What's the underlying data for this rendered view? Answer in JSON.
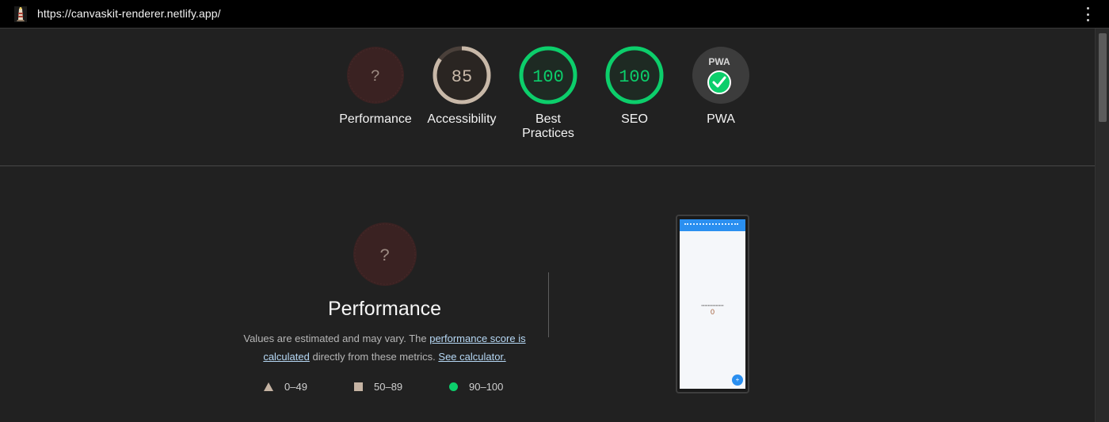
{
  "browser": {
    "url": "https://canvaskit-renderer.netlify.app/",
    "favicon_icon": "lighthouse-icon",
    "menu_icon": "kebab-menu-icon"
  },
  "gauges": [
    {
      "label": "Performance",
      "score": "?",
      "value": null,
      "status": "error",
      "color": "#5a2a2a"
    },
    {
      "label": "Accessibility",
      "score": "85",
      "value": 85,
      "status": "average",
      "color": "#c8b8a8"
    },
    {
      "label": "Best Practices",
      "score": "100",
      "value": 100,
      "status": "pass",
      "color": "#0cce6b"
    },
    {
      "label": "SEO",
      "score": "100",
      "value": 100,
      "status": "pass",
      "color": "#0cce6b"
    },
    {
      "label": "PWA",
      "badge_text": "PWA",
      "status": "installable",
      "check_icon": "check-circle-icon"
    }
  ],
  "performance": {
    "score": "?",
    "title": "Performance",
    "desc_prefix": "Values are estimated and may vary. The ",
    "link_score": "performance score is calculated",
    "desc_middle": " directly from these metrics. ",
    "link_calculator": "See calculator."
  },
  "legend": [
    {
      "shape": "triangle-icon",
      "range": "0–49",
      "color": "#c5b3a3"
    },
    {
      "shape": "square-icon",
      "range": "50–89",
      "color": "#c5b3a3"
    },
    {
      "shape": "circle-icon",
      "range": "90–100",
      "color": "#0cce6b"
    }
  ],
  "screenshot": {
    "counter": "0",
    "fab_label": "+"
  },
  "colors": {
    "background": "#212121",
    "pass": "#0cce6b",
    "average_ring": "#c8b8a8",
    "error_fill": "#3a2222",
    "link": "#b6d8f5"
  }
}
